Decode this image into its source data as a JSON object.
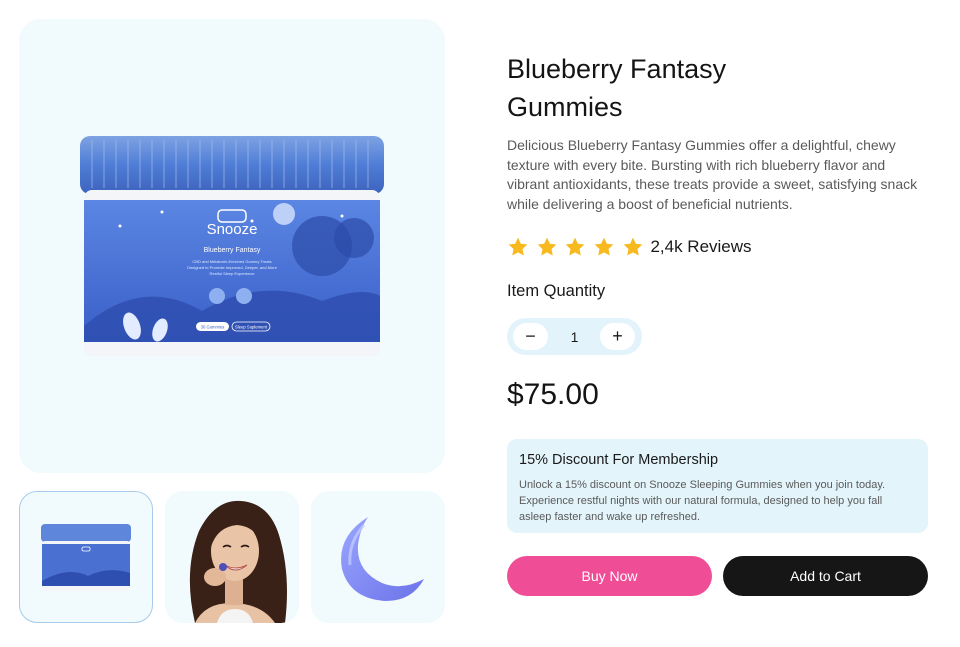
{
  "product": {
    "title_line1": "Blueberry Fantasy",
    "title_line2": "Gummies",
    "description": "Delicious Blueberry Fantasy Gummies offer a delightful, chewy texture with every bite. Bursting with rich blueberry flavor and vibrant antioxidants, these treats provide a sweet, satisfying snack while delivering a boost of beneficial nutrients.",
    "rating_stars": 5,
    "reviews": "2,4k Reviews",
    "price": "$75.00"
  },
  "jar_label": {
    "brand": "Snooze",
    "product_name": "Blueberry Fantasy",
    "line1": "CBD and Melatonin-Enriched Gummy Treats",
    "line2": "Designed to Promote Improved, Deeper, and More",
    "line3": "Restful Sleep Experience",
    "count_badge": "30 Gummies",
    "type_badge": "Sleep Suplement"
  },
  "quantity": {
    "label": "Item Quantity",
    "minus": "−",
    "value": "1",
    "plus": "+"
  },
  "discount": {
    "title": "15% Discount For Membership",
    "text": "Unlock a 15% discount on Snooze Sleeping Gummies when you join today. Experience restful nights with our natural formula, designed to help you fall asleep faster and wake up refreshed."
  },
  "actions": {
    "buy_now": "Buy Now",
    "add_to_cart": "Add to Cart"
  },
  "colors": {
    "accent_pink": "#ef4e96",
    "dark": "#161616",
    "star": "#f7b91e",
    "panel": "#f1fafd",
    "discount_bg": "#e3f4fb"
  },
  "icons": {
    "star": "star-icon",
    "moon": "crescent-moon-icon"
  }
}
